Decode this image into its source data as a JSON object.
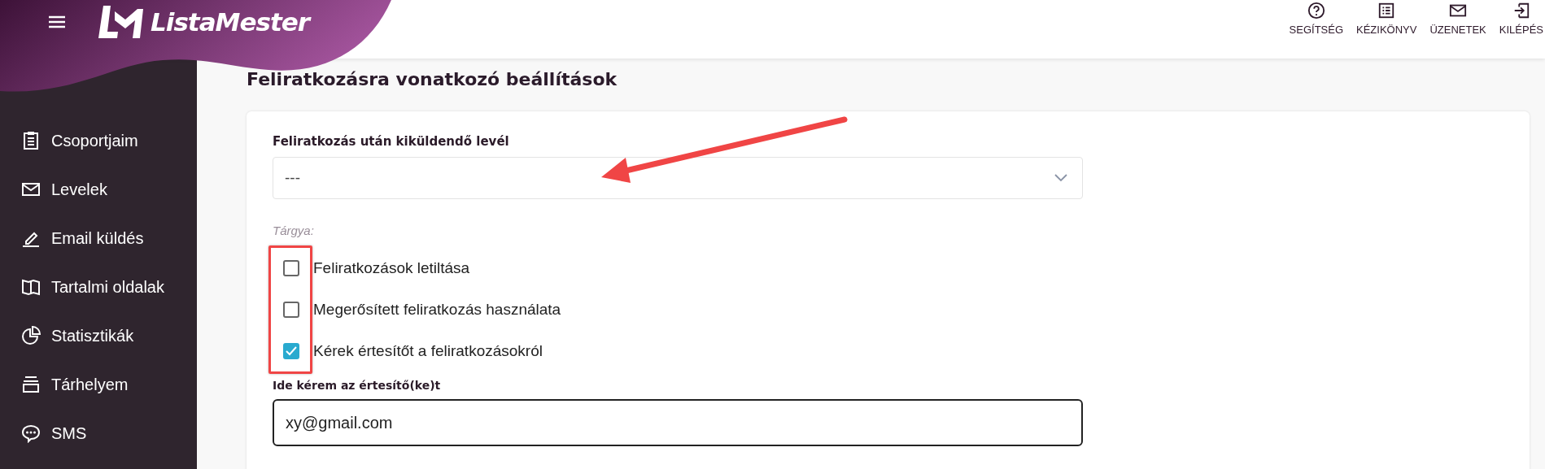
{
  "header": {
    "brand": "ListaMester",
    "actions": [
      {
        "kind": "help",
        "label": "SEGÍTSÉG"
      },
      {
        "kind": "manual",
        "label": "KÉZIKÖNYV"
      },
      {
        "kind": "messages",
        "label": "ÜZENETEK"
      },
      {
        "kind": "logout",
        "label": "KILÉPÉS"
      }
    ]
  },
  "sidebar": {
    "items": [
      {
        "kind": "groups",
        "label": "Csoportjaim"
      },
      {
        "kind": "letters",
        "label": "Levelek"
      },
      {
        "kind": "send",
        "label": "Email küldés"
      },
      {
        "kind": "pages",
        "label": "Tartalmi oldalak"
      },
      {
        "kind": "stats",
        "label": "Statisztikák"
      },
      {
        "kind": "storage",
        "label": "Tárhelyem"
      },
      {
        "kind": "sms",
        "label": "SMS"
      }
    ]
  },
  "page_title": "Feliratkozásra vonatkozó beállítások",
  "form": {
    "letter_select": {
      "label": "Feliratkozás után kiküldendő levél",
      "value": "---",
      "arrow_pointer": true
    },
    "subject_label": "Tárgya:",
    "checkboxes_highlighted": true,
    "checkboxes": [
      {
        "label": "Feliratkozások letiltása",
        "checked": false
      },
      {
        "label": "Megerősített feliratkozás használata",
        "checked": false
      },
      {
        "label": "Kérek értesítőt a feliratkozásokról",
        "checked": true
      }
    ],
    "notify_field": {
      "label": "Ide kérem az értesítő(ke)t",
      "value": "xy@gmail.com"
    }
  }
}
